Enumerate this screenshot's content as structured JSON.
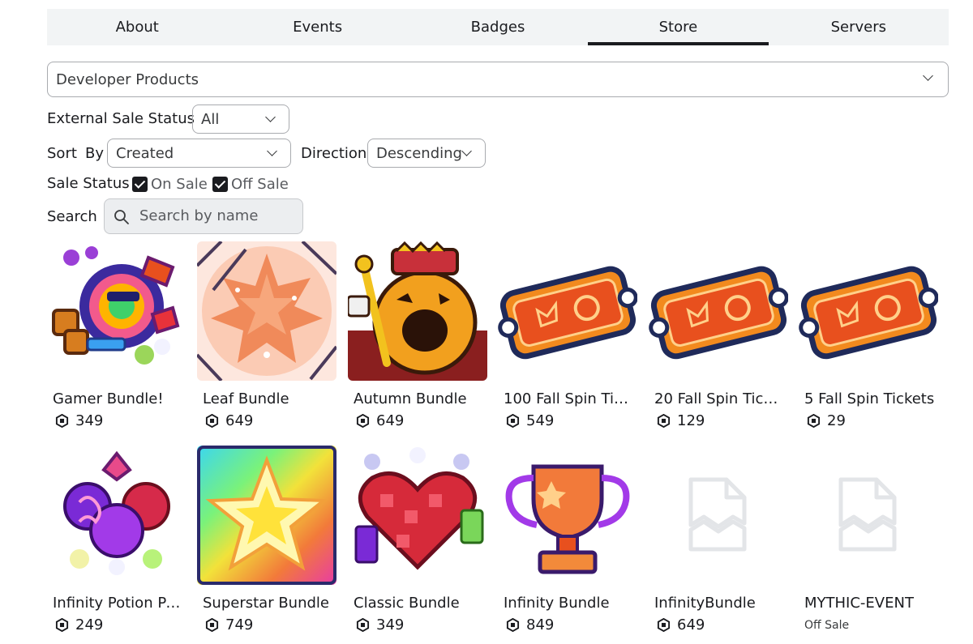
{
  "tabs": [
    {
      "label": "About"
    },
    {
      "label": "Events"
    },
    {
      "label": "Badges"
    },
    {
      "label": "Store",
      "active": true
    },
    {
      "label": "Servers"
    }
  ],
  "category": {
    "value": "Developer Products"
  },
  "filters": {
    "external_sale_status": {
      "label": "External Sale Status",
      "value": "All"
    },
    "sort_by": {
      "label_sort": "Sort",
      "label_by": "By",
      "value": "Created"
    },
    "direction": {
      "label": "Direction",
      "value": "Descending"
    },
    "sale_status": {
      "label": "Sale Status",
      "on_sale": "On Sale",
      "off_sale": "Off Sale",
      "on_sale_checked": true,
      "off_sale_checked": true
    },
    "search": {
      "label": "Search",
      "placeholder": "Search by name"
    }
  },
  "items": [
    {
      "name": "Gamer Bundle!",
      "price": "349",
      "icon": "gamer-bundle-icon"
    },
    {
      "name": "Leaf Bundle",
      "price": "649",
      "icon": "leaf-bundle-icon"
    },
    {
      "name": "Autumn Bundle",
      "price": "649",
      "icon": "autumn-bundle-icon"
    },
    {
      "name": "100 Fall Spin Tick…",
      "price": "549",
      "icon": "ticket-icon"
    },
    {
      "name": "20 Fall Spin Ticke…",
      "price": "129",
      "icon": "ticket-icon"
    },
    {
      "name": "5 Fall Spin Tickets",
      "price": "29",
      "icon": "ticket-icon"
    },
    {
      "name": "Infinity Potion Pa…",
      "price": "249",
      "icon": "potion-pack-icon"
    },
    {
      "name": "Superstar Bundle",
      "price": "749",
      "icon": "superstar-icon"
    },
    {
      "name": "Classic Bundle",
      "price": "349",
      "icon": "classic-heart-icon"
    },
    {
      "name": "Infinity Bundle",
      "price": "849",
      "icon": "trophy-icon"
    },
    {
      "name": "InfinityBundle",
      "price": "649",
      "icon": "placeholder-image-icon"
    },
    {
      "name": "MYTHIC-EVENT",
      "status": "Off Sale",
      "icon": "placeholder-image-icon"
    }
  ],
  "colors": {
    "text": "#1a1b1f",
    "tab_bg": "#f2f4f5",
    "border": "#a9abaf",
    "accent_orange": "#e8501e"
  }
}
